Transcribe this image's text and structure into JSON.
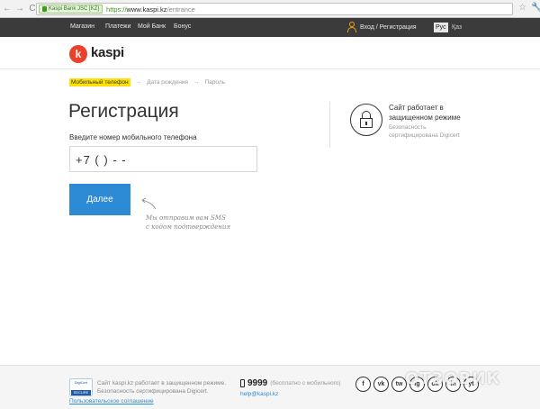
{
  "browser": {
    "back": "←",
    "forward": "→",
    "reload": "C",
    "ev_badge": "Kaspi Bank JSC [KZ]",
    "url_scheme": "https://",
    "url_host": "www.kaspi.kz",
    "url_path": "/entrance",
    "star": "☆",
    "menu": "🔧"
  },
  "topnav": {
    "items": [
      "Магазин",
      "Платежи",
      "Мой Банк",
      "Бонус"
    ],
    "login": "Вход / Регистрация",
    "lang_active": "Рус",
    "lang_other": "Қаз"
  },
  "logo": {
    "mark": "k",
    "text": "kaspi"
  },
  "steps": [
    "Мобильный телефон",
    "Дата рождения",
    "Пароль"
  ],
  "step_arrow": "→",
  "form": {
    "title": "Регистрация",
    "phone_label": "Введите номер мобильного телефона",
    "phone_value": "+7 (  )   -  -",
    "next_button": "Далее",
    "hint_line1": "Мы отправим вам SMS",
    "hint_line2": "с кодом подтверждения"
  },
  "security": {
    "title_line1": "Сайт работает в",
    "title_line2": "защищенном режиме",
    "sub_line1": "Безопасность",
    "sub_line2": "сертифицирована Digicert"
  },
  "footer": {
    "digicert_top": "DigiCert",
    "digicert_bottom": "SECURE",
    "sec_line1": "Сайт kaspi.kz работает в защищенном режиме.",
    "sec_line2": "Безопасность сертифицирована Digicert.",
    "terms": "Пользовательское соглашение",
    "phone": "9999",
    "phone_note": "(бесплатно с мобильного)",
    "email": "help@kaspi.kz",
    "social": [
      "f",
      "vk",
      "tw",
      "ig",
      "ok",
      "in",
      "yt"
    ]
  },
  "watermark": "ОТЗОВИК"
}
